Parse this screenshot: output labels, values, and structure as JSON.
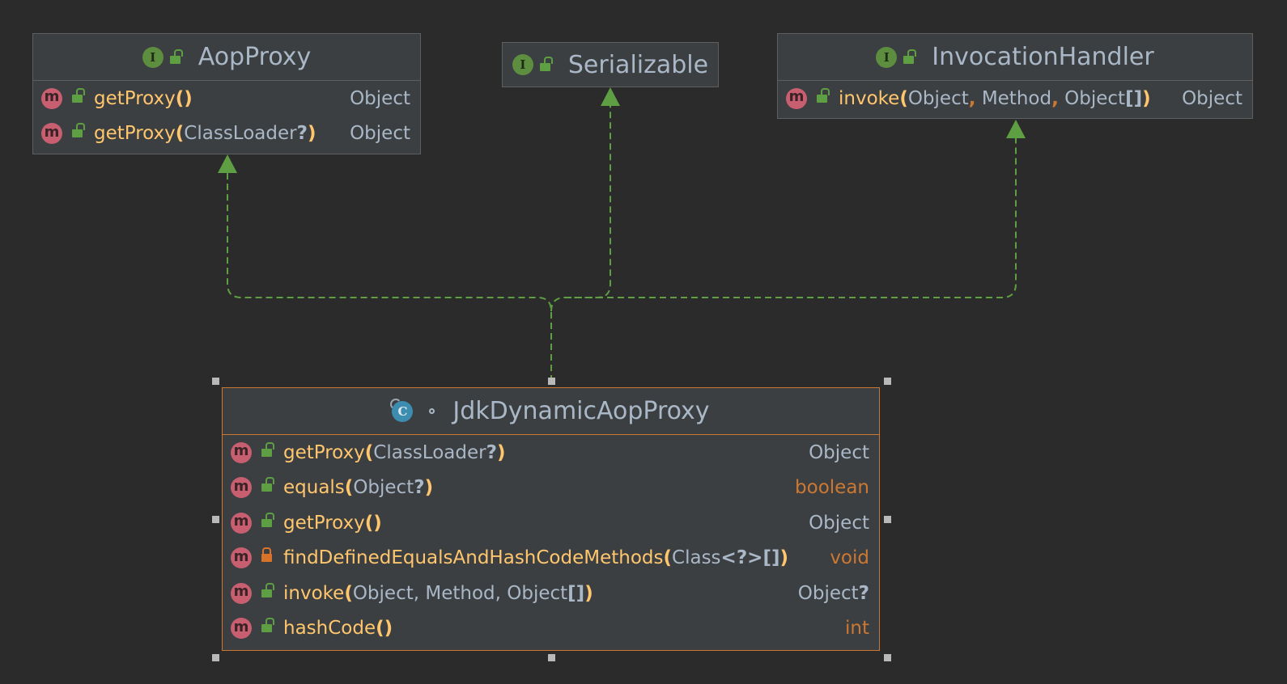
{
  "diagram": {
    "interfaces": [
      {
        "id": "aopproxy",
        "name": "AopProxy",
        "kind_icon": "interface-icon",
        "kind_letter": "I",
        "members": [
          {
            "name": "getProxy",
            "open": "(",
            "params": "",
            "close": ")",
            "returns": "Object"
          },
          {
            "name": "getProxy",
            "open": "(",
            "params": "ClassLoader",
            "nullable": "?",
            "close": ")",
            "returns": "Object"
          }
        ]
      },
      {
        "id": "serializable",
        "name": "Serializable",
        "kind_icon": "interface-icon",
        "kind_letter": "I",
        "members": []
      },
      {
        "id": "invocationhandler",
        "name": "InvocationHandler",
        "kind_icon": "interface-icon",
        "kind_letter": "I",
        "members": [
          {
            "name": "invoke",
            "open": "(",
            "p1": "Object",
            "p2": "Method",
            "p3": "Object",
            "arr": "[]",
            "close": ")",
            "sep": ",",
            "returns": "Object"
          }
        ]
      }
    ],
    "class": {
      "id": "jdkdynamicaopproxy",
      "name": "JdkDynamicAopProxy",
      "kind_icon": "class-icon",
      "kind_letter": "C",
      "members": [
        {
          "name": "getProxy",
          "params": "ClassLoader",
          "returns": "Object",
          "visibility": "public"
        },
        {
          "name": "equals",
          "params": "Object",
          "returns": "boolean",
          "visibility": "public"
        },
        {
          "name": "getProxy",
          "params": "",
          "returns": "Object",
          "visibility": "public"
        },
        {
          "name": "findDefinedEqualsAndHashCodeMethods",
          "params": "Class",
          "generic": "<?>",
          "returns": "void",
          "visibility": "private"
        },
        {
          "name": "invoke",
          "params": "Object, Method, Object",
          "returns": "Object",
          "visibility": "public"
        },
        {
          "name": "hashCode",
          "params": "",
          "returns": "int",
          "visibility": "public"
        }
      ]
    },
    "symbols": {
      "open": "(",
      "close": ")",
      "q": "?",
      "arr": "[]",
      "comma": ",",
      "method_letter": "m"
    },
    "colors": {
      "background": "#2b2b2b",
      "node_fill": "#3c3f41",
      "node_border": "#5e6060",
      "selected_border": "#cc7832",
      "edge": "#5e9f43",
      "method_name": "#ffc66d",
      "keyword": "#cc7832",
      "text": "#a9b7c6"
    },
    "relations": [
      {
        "from": "jdkdynamicaopproxy",
        "to": "aopproxy",
        "type": "implements"
      },
      {
        "from": "jdkdynamicaopproxy",
        "to": "serializable",
        "type": "implements"
      },
      {
        "from": "jdkdynamicaopproxy",
        "to": "invocationhandler",
        "type": "implements"
      }
    ]
  }
}
